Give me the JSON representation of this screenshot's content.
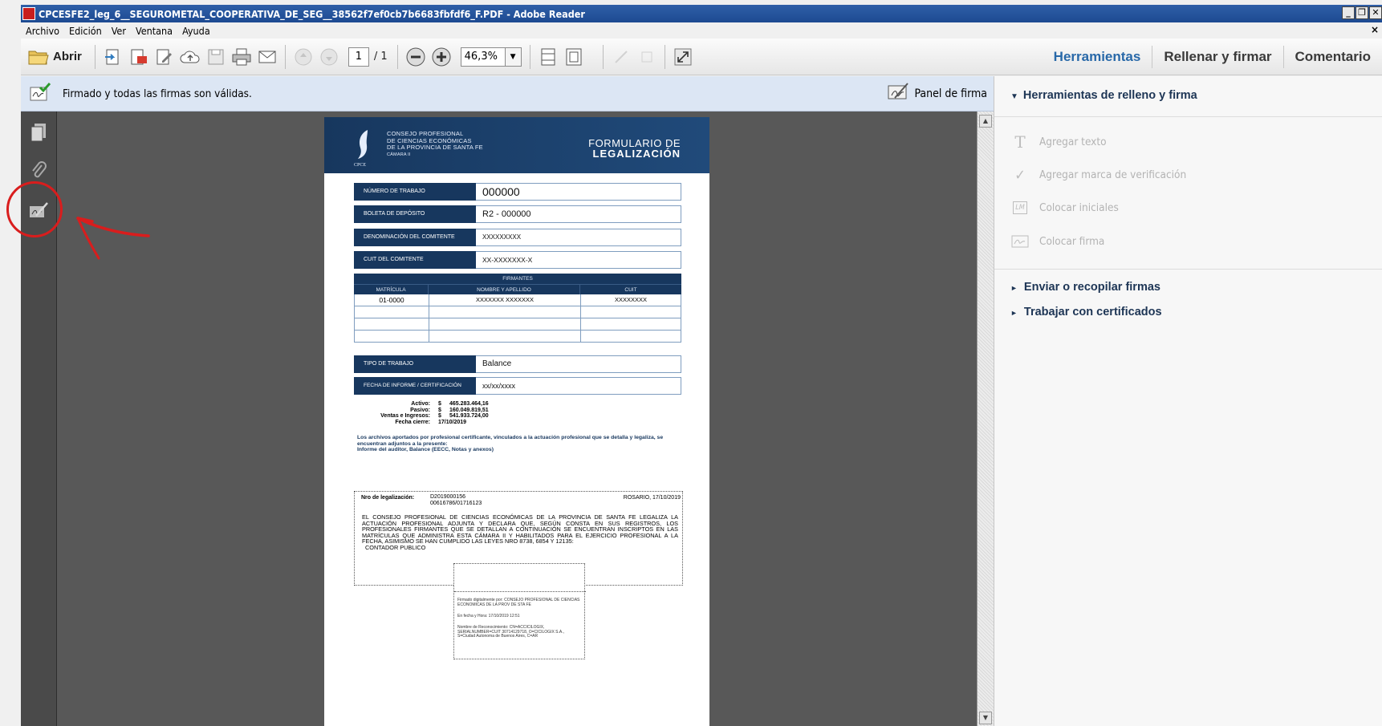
{
  "window": {
    "title": "CPCESFE2_leg_6__SEGUROMETAL_COOPERATIVA_DE_SEG__38562f7ef0cb7b6683fbfdf6_F.PDF - Adobe Reader",
    "buttons": {
      "minimize": "_",
      "restore": "❐",
      "close": "✕"
    }
  },
  "menu": {
    "items": [
      "Archivo",
      "Edición",
      "Ver",
      "Ventana",
      "Ayuda"
    ],
    "close": "×"
  },
  "toolbar": {
    "open_label": "Abrir",
    "page_current": "1",
    "page_total": "/ 1",
    "zoom": "46,3%",
    "zoom_dropdown": "▼",
    "right": {
      "tools": "Herramientas",
      "fill_sign": "Rellenar y firmar",
      "comment": "Comentario"
    }
  },
  "signature_bar": {
    "status": "Firmado y todas las firmas son válidas.",
    "panel_button": "Panel de firma"
  },
  "right_pane": {
    "section_fill_sign": "Herramientas de relleno y firma",
    "section_fill_sign_arrow": "▼",
    "items": {
      "add_text": "Agregar texto",
      "add_check": "Agregar marca de verificación",
      "initials": "Colocar iniciales",
      "signature": "Colocar firma"
    },
    "icon_text": "T",
    "icon_check": "✓",
    "icon_initials": "LM",
    "section_send": "Enviar o recopilar firmas",
    "section_certs": "Trabajar con certificados",
    "collapsed_arrow": "►"
  },
  "scrollbar": {
    "up": "▲",
    "down": "▼"
  },
  "document": {
    "org": [
      "CONSEJO PROFESIONAL",
      "DE CIENCIAS ECONÓMICAS",
      "DE LA PROVINCIA DE SANTA FE",
      "CÁMARA II"
    ],
    "cpce": "CPCE",
    "form_title_1": "FORMULARIO DE",
    "form_title_2": "LEGALIZACIÓN",
    "fields": {
      "numero_trabajo": {
        "label": "NÚMERO DE TRABAJO",
        "value": "000000"
      },
      "boleta": {
        "label": "BOLETA DE DEPÓSITO",
        "value": "R2 - 000000"
      },
      "denominacion": {
        "label": "DENOMINACIÓN DEL COMITENTE",
        "value": "XXXXXXXXX"
      },
      "cuit": {
        "label": "CUIT DEL COMITENTE",
        "value": "XX-XXXXXXX-X"
      },
      "tipo": {
        "label": "TIPO DE TRABAJO",
        "value": "Balance"
      },
      "fecha": {
        "label": "FECHA DE INFORME / CERTIFICACIÓN",
        "value": "xx/xx/xxxx"
      }
    },
    "firmantes": {
      "title": "FIRMANTES",
      "headers": [
        "MATRÍCULA",
        "NOMBRE Y APELLIDO",
        "CUIT"
      ],
      "rows": [
        [
          "01-0000",
          "XXXXXXX      XXXXXXX",
          "XXXXXXXX"
        ],
        [
          "",
          "",
          ""
        ],
        [
          "",
          "",
          ""
        ],
        [
          "",
          "",
          ""
        ]
      ]
    },
    "summary": {
      "labels": [
        "Activo:",
        "Pasivo:",
        "Ventas e Ingresos:",
        "Fecha cierre:"
      ],
      "currency": "$",
      "values": [
        "465.283.464,16",
        "160.049.819,51",
        "541.933.724,00"
      ],
      "fecha_cierre": "17/10/2019"
    },
    "archivos_text": "Los archivos aportados por profesional certificante, vinculados a la actuación profesional que se detalla y legaliza, se encuentran adjuntos a la presente:",
    "archivos_list": "Informe del auditor, Balance (EECC, Notas y anexos)",
    "legalizacion": {
      "label": "Nro de legalización:",
      "nro": "D2019000156",
      "nro2": "00616786/01716123",
      "place_date": "ROSARIO, 17/10/2019",
      "text": "EL CONSEJO PROFESIONAL DE CIENCIAS ECONÓMICAS DE LA PROVINCIA DE SANTA FE LEGALIZA LA ACTUACIÓN PROFESIONAL ADJUNTA Y DECLARA QUE, SEGÚN CONSTA EN SUS REGISTROS, LOS PROFESIONALES FIRMANTES QUE SE DETALLAN A CONTINUACIÓN SE ENCUENTRAN INSCRIPTOS EN LAS MATRÍCULAS QUE ADMINISTRA ESTA CÁMARA II Y HABILITADOS PARA EL EJERCICIO PROFESIONAL A LA FECHA, ASIMISMO SE HAN CUMPLIDO LAS LEYES NRO 8738, 6854 Y 12135:",
      "role": "CONTADOR PUBLICO"
    },
    "stamp": {
      "line1": "Firmado digitalmente por: CONSEJO PROFESIONAL DE CIENCIAS ECONOMICAS DE LA PROV DE STA FE",
      "line2": "En fecha y Hora: 17/10/2019 12:51",
      "line3": "Nombre de Reconocimiento: CN=ACCICILOGIX, SERIALNUMBER=CUIT 30714129718, O=CICILOGIX S.A., S=Ciudad Autonoma de Buenos Aires, C=AR"
    }
  }
}
